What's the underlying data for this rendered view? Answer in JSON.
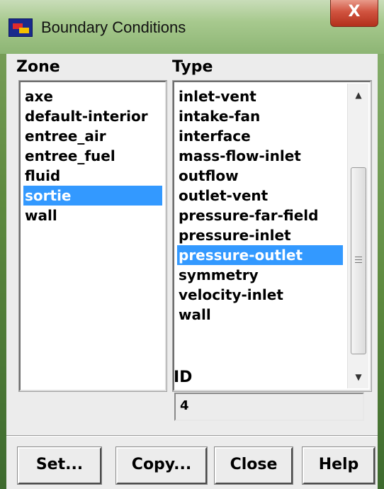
{
  "window": {
    "title": "Boundary Conditions",
    "close_glyph": "X",
    "icon": "fluent-app-icon"
  },
  "zone": {
    "label": "Zone",
    "items": [
      "axe",
      "default-interior",
      "entree_air",
      "entree_fuel",
      "fluid",
      "sortie",
      "wall"
    ],
    "selected": "sortie"
  },
  "type": {
    "label": "Type",
    "items": [
      "inlet-vent",
      "intake-fan",
      "interface",
      "mass-flow-inlet",
      "outflow",
      "outlet-vent",
      "pressure-far-field",
      "pressure-inlet",
      "pressure-outlet",
      "symmetry",
      "velocity-inlet",
      "wall"
    ],
    "selected": "pressure-outlet",
    "scroll_up_icon": "scroll-up-arrow-icon",
    "scroll_down_icon": "scroll-down-arrow-icon"
  },
  "id": {
    "label": "ID",
    "value": "4"
  },
  "buttons": {
    "set": "Set...",
    "copy": "Copy...",
    "close": "Close",
    "help": "Help"
  },
  "colors": {
    "selection": "#3399ff",
    "dialog_bg": "#ececec",
    "close_button": "#c8442f"
  }
}
